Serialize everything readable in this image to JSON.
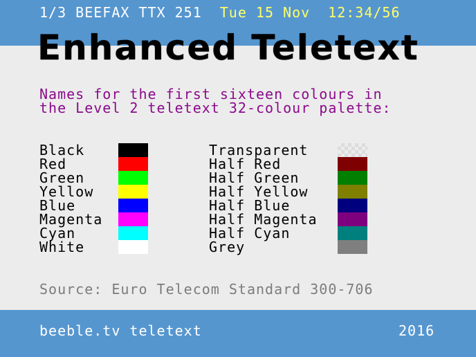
{
  "header": {
    "page": "1/3 BEEFAX TTX 251",
    "date": "Tue 15 Nov",
    "time": "12:34/56"
  },
  "title": "Enhanced Teletext",
  "intro": {
    "line1": "Names for the first sixteen colours in",
    "line2": "the Level 2 teletext 32-colour palette:"
  },
  "colours_left": [
    {
      "name": "Black",
      "color": "#000000"
    },
    {
      "name": "Red",
      "color": "#ff0000"
    },
    {
      "name": "Green",
      "color": "#00ff00"
    },
    {
      "name": "Yellow",
      "color": "#ffff00"
    },
    {
      "name": "Blue",
      "color": "#0000ff"
    },
    {
      "name": "Magenta",
      "color": "#ff00ff"
    },
    {
      "name": "Cyan",
      "color": "#00ffff"
    },
    {
      "name": "White",
      "color": "#ffffff"
    }
  ],
  "colours_right": [
    {
      "name": "Transparent",
      "color": "transparent"
    },
    {
      "name": "Half Red",
      "color": "#7f0000"
    },
    {
      "name": "Half Green",
      "color": "#007f00"
    },
    {
      "name": "Half Yellow",
      "color": "#7f7f00"
    },
    {
      "name": "Half Blue",
      "color": "#00007f"
    },
    {
      "name": "Half Magenta",
      "color": "#7f007f"
    },
    {
      "name": "Half Cyan",
      "color": "#007f7f"
    },
    {
      "name": "Grey",
      "color": "#7f7f7f"
    }
  ],
  "source": "Source: Euro Telecom Standard 300-706",
  "footer": {
    "left": "beeble.tv teletext",
    "right": "2016"
  },
  "theme": {
    "band": "#5696cf",
    "background": "#ececec",
    "intro_text": "#8a0a8a",
    "header_highlight": "#ffff66"
  }
}
